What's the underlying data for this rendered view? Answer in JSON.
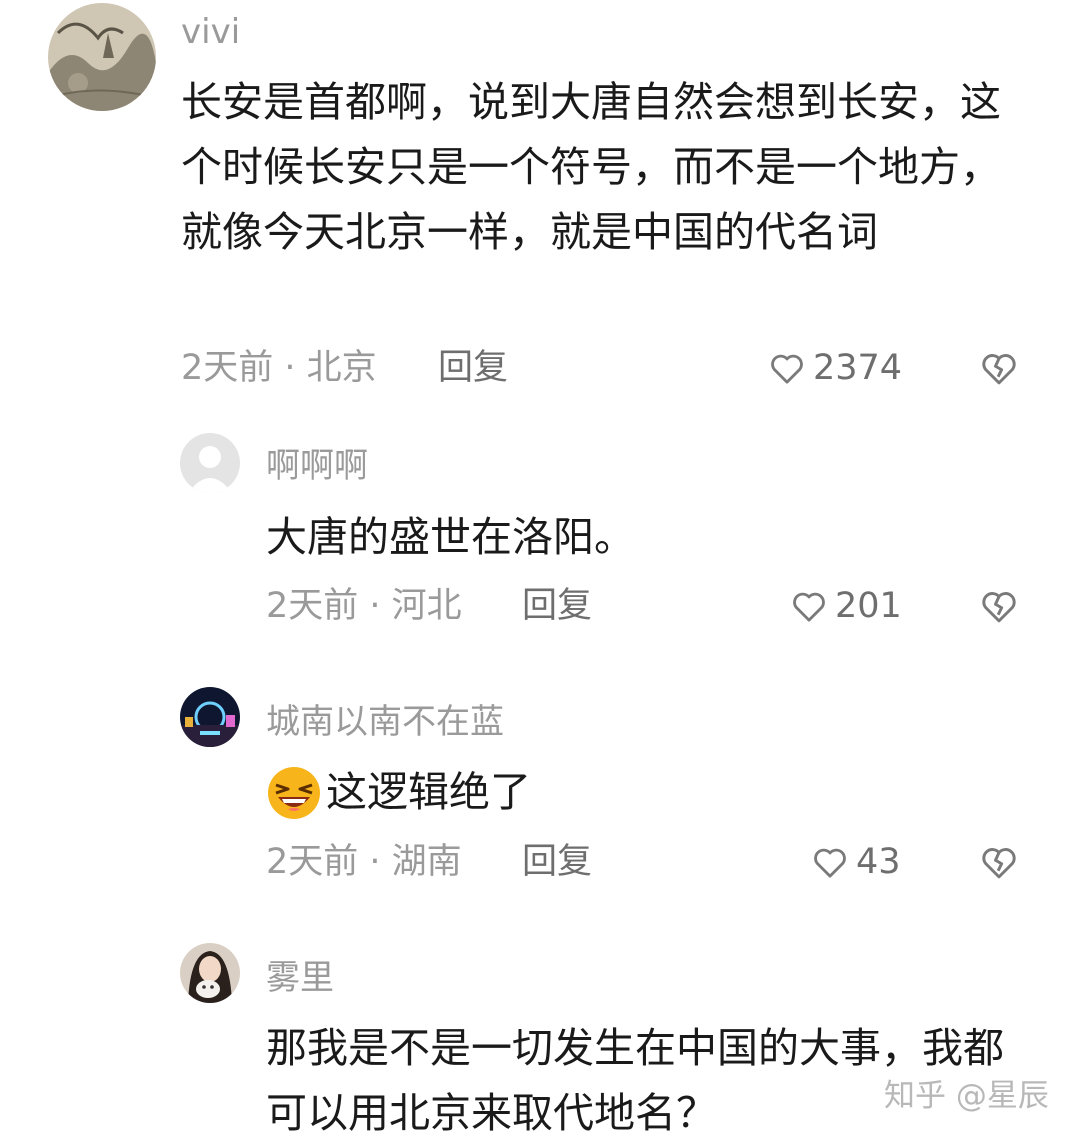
{
  "comments": [
    {
      "username": "vivi",
      "text": "长安是首都啊，说到大唐自然会想到长安，这个时候长安只是一个符号，而不是一个地方，就像今天北京一样，就是中国的代名词",
      "meta": "2天前 · 北京",
      "reply_label": "回复",
      "likes": "2374",
      "avatar": "landscape-painting"
    },
    {
      "username": "啊啊啊",
      "text": "大唐的盛世在洛阳。",
      "meta": "2天前 · 河北",
      "reply_label": "回复",
      "likes": "201",
      "avatar": "default-user"
    },
    {
      "username": "城南以南不在蓝",
      "text": "这逻辑绝了",
      "meta": "2天前 · 湖南",
      "reply_label": "回复",
      "likes": "43",
      "avatar": "night-city",
      "emoji": "laughing-face"
    },
    {
      "username": "雾里",
      "text": "那我是不是一切发生在中国的大事，我都可以用北京来取代地名？",
      "avatar": "portrait-with-cat"
    }
  ],
  "watermark": "知乎 @星辰",
  "colors": {
    "meta": "#9a9a9a",
    "text": "#1a1a1a",
    "icon": "#7a7a7a"
  }
}
